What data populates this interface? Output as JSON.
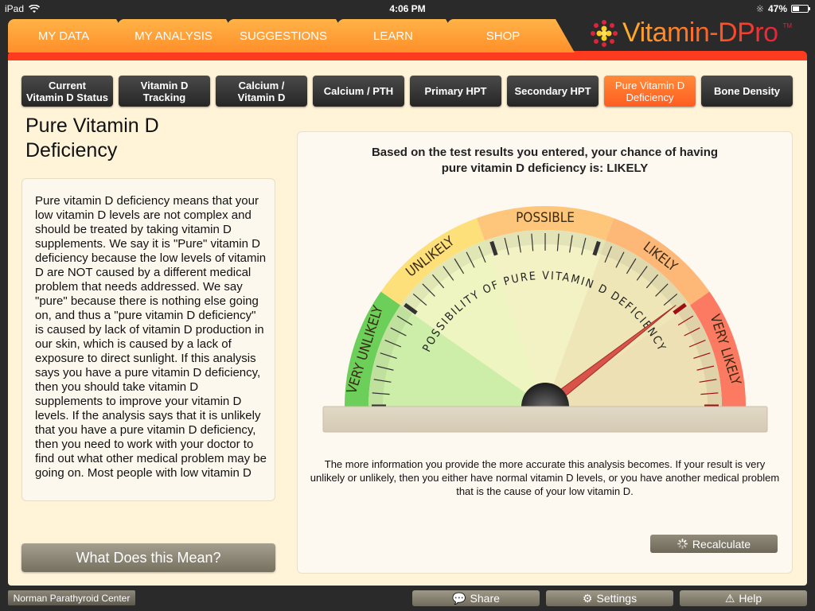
{
  "status_bar": {
    "device": "iPad",
    "time": "4:06 PM",
    "battery": "47%",
    "battery_level": 0.47
  },
  "main_tabs": [
    {
      "label": "MY DATA",
      "active": false
    },
    {
      "label": "MY ANALYSIS",
      "active": true
    },
    {
      "label": "SUGGESTIONS",
      "active": false
    },
    {
      "label": "LEARN",
      "active": false
    },
    {
      "label": "SHOP",
      "active": false
    }
  ],
  "logo": {
    "text": "Vitamin-DPro",
    "tm": "TM"
  },
  "sub_tabs": [
    {
      "line1": "Current",
      "line2": "Vitamin D Status",
      "active": false
    },
    {
      "line1": "Vitamin D",
      "line2": "Tracking",
      "active": false
    },
    {
      "line1": "Calcium /",
      "line2": "Vitamin D",
      "active": false
    },
    {
      "line1": "Calcium / PTH",
      "line2": "",
      "active": false
    },
    {
      "line1": "Primary HPT",
      "line2": "",
      "active": false
    },
    {
      "line1": "Secondary HPT",
      "line2": "",
      "active": false
    },
    {
      "line1": "Pure Vitamin D",
      "line2": "Deficiency",
      "active": true
    },
    {
      "line1": "Bone Density",
      "line2": "",
      "active": false
    }
  ],
  "page": {
    "title_line1": "Pure Vitamin D",
    "title_line2": "Deficiency",
    "description": "Pure vitamin D deficiency means that your low vitamin D levels are not complex and should be treated by taking vitamin D supplements. We say it is \"Pure\" vitamin D deficiency because the low levels of vitamin D are NOT caused by a different medical problem that needs addressed. We say \"pure\" because there is nothing else going on, and thus a \"pure vitamin D deficiency\" is caused by lack of vitamin D production in our skin, which is caused by a lack of exposure to direct sunlight. If this analysis says you have a pure vitamin D deficiency, then you should take vitamin D supplements to improve your vitamin D levels. If the analysis says that it is unlikely that you have a pure vitamin D deficiency, then you need to work with your doctor to find out what other medical problem may be going on. Most people with low vitamin D",
    "meaning_button": "What Does this Mean?"
  },
  "result": {
    "heading_line1": "Based on the test results you entered, your chance of having",
    "heading_line2": "pure vitamin D deficiency is: LIKELY",
    "gauge": {
      "inner_label": "POSSIBILITY OF PURE VITAMIN D DEFICIENCY",
      "needle_fraction": 0.79,
      "segments": [
        {
          "label": "VERY UNLIKELY",
          "color": "#6ccf5a",
          "inner_color": "#cdeea8"
        },
        {
          "label": "UNLIKELY",
          "color": "#fde07a",
          "inner_color": "#eef5c0"
        },
        {
          "label": "POSSIBLE",
          "color": "#fdc67a",
          "inner_color": "#f2f2c4"
        },
        {
          "label": "LIKELY",
          "color": "#fdb878",
          "inner_color": "#efe6b8"
        },
        {
          "label": "VERY LIKELY",
          "color": "#fc7a62",
          "inner_color": "#ede0b4"
        }
      ],
      "needle_color": "#d9534a"
    },
    "note": "The more information you provide the more accurate this analysis becomes. If your result is very unlikely or unlikely, then you either have normal vitamin D levels, or you have another medical problem that is the cause of your low vitamin D.",
    "recalculate_label": "Recalculate"
  },
  "footer": {
    "center_link": "Norman Parathyroid Center",
    "share": "Share",
    "settings": "Settings",
    "help": "Help"
  }
}
